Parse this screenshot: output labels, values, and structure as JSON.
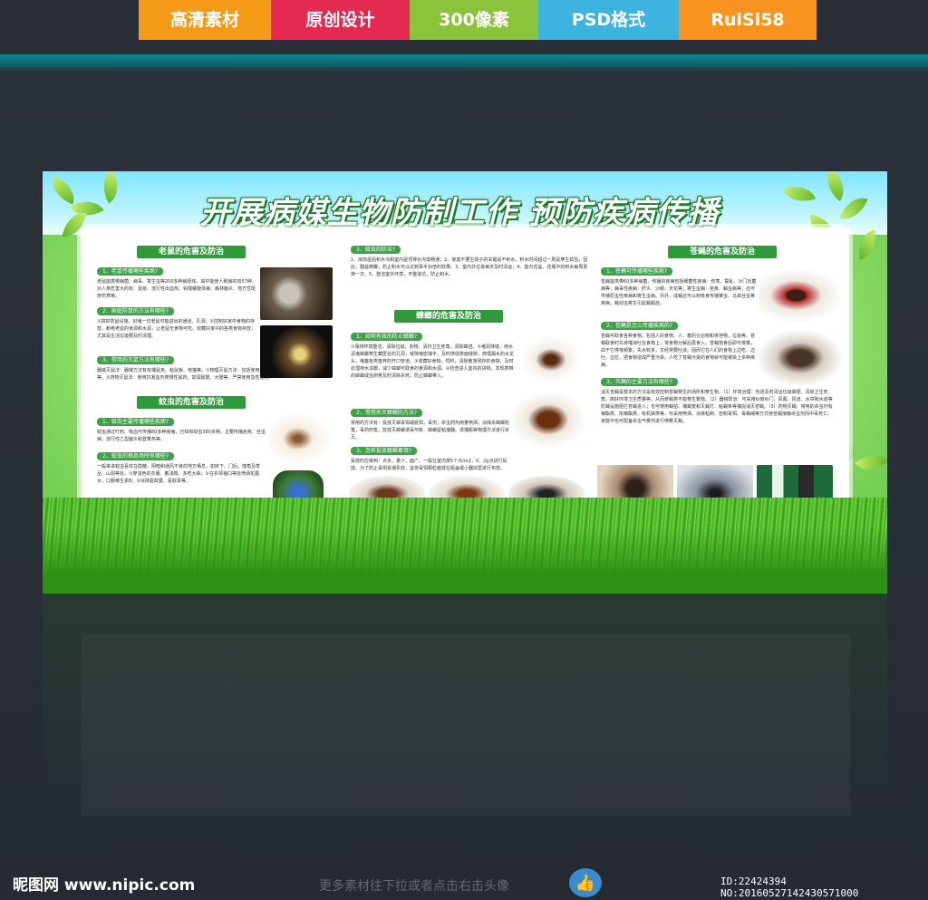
{
  "tags": [
    {
      "label": "高清素材",
      "color": "#f59a16"
    },
    {
      "label": "原创设计",
      "color": "#e42a50"
    },
    {
      "label": "300像素",
      "color": "#8bc33a"
    },
    {
      "label": "PSD格式",
      "color": "#3cb4df"
    },
    {
      "label": "RuiSi58",
      "color": "#f7931e"
    }
  ],
  "board": {
    "title": "开展病媒生物防制工作 预防疾病传播",
    "sections": {
      "rats": "老鼠的危害及防治",
      "mosquito": "蚊虫的危害及防治",
      "mosquito_cont": "3、蚊虫的防治?",
      "cockroach": "蟑螂的危害及防治",
      "fly": "苍蝇的危害及防治"
    },
    "subs": {
      "rat1": "1、老鼠传播哪些疾病?",
      "rat2": "2、家庭防鼠的方法有哪些?",
      "rat3": "3、常用的灭鼠方法有哪些?",
      "mos1": "1、蚊虫主要传播哪些疾病?",
      "mos2": "2、蚊虫的栖息场所有哪些?",
      "roach1": "1、如何有效的防止蟑螂?",
      "roach2": "2、常用杀灭蟑螂的方法?",
      "roach3": "3、怎样投放蟑螂毒饵?",
      "fly1": "1、苍蝇可传播哪些疾病?",
      "fly2": "2、苍蝇是怎么传播疾病的?",
      "fly3": "3、灭蝇的主要方法有哪些?"
    },
    "paras": {
      "rat1": "老鼠能携带病菌、病毒、寄生虫等200多种病原体，其中能使人致病的有57种，对人类危害大的有：鼠疫、流行性出血热、钩端螺旋体病、森林脑炎、地方性斑疹伤寒等。",
      "rat2": "①搞好防鼠设施，封堵一切老鼠可能进出的通道、孔洞；②控制好家中食物的存放，断绝老鼠的食源和水源，让老鼠无食物可吃。收藏好家中的各类食物存放；尤其是生活垃圾要及时清理。",
      "rat3": "器械灭鼠法：器械方法有有捕鼠夹、粘鼠板、电猫等。①物理灭鼠方法：包括使用鼠夹、鼠笼、粘鼠板、电猫等。②药物灭鼠法：使用抗凝血剂类慢性鼠药，如溴敌隆、大隆等，严禁使用急性鼠药。",
      "mos1": "蚊虫通过叮刺、吸血可传播80多种疾病，已知有蚊虫380多种。主要传播疟疾、丝虫病、流行性乙型脑炎和登革热等。",
      "mos2": "一般来讲蚊虫喜欢在隐蔽、阴暗和通风不良的地方栖息，如床下、门后、墙角及草丛、山洞等处。①穿浅色的衣服、戴浅帽、多吃大蒜；②在衣领袖口等处喷洒花露水，口服维生素B；③涂抹驱蚊露、驱蚊膏等。",
      "mos3": "1、房前屋后积水沟和室内屋顶排水沟需畅通；2、家庭不要生蚊子的关键是不积水，积水时间超过一周是孳生蚊虫，因此，翻盆倒罐，防止积水可以达到事半功倍的效果。3、室内外垃圾每天及时清运；4、室内花盆、花瓶中的积水每周更换一次。5、整洁室外环境，平整道坑，防止积水。",
      "roach1": "①保持环境整洁，清除垃圾、杂物，清扫卫生死角，清除蟑迹。②堵洞抹缝，用水泥堵蟑螂孳生藏匿处的孔洞，缝隙堵密填平，及时修缮表面缝隙，修理漏水的水龙头，堵塞各类废弃的开口管道。③收藏好食物，饲料，清除散落残存的食物，及时处理用水泔脚，减少蟑螂可取食的食源和水源。④检查进入室内的货物，发现携带的蟑螂成虫卵荚及时清除杀死，防止蟑螂带入。",
      "roach2": "常用的方法有：投放灭蟑毒饵或胶饵，毒剂；杀虫药剂用量喷洒；涂抹杀蟑螂粉笔，毒药药笔，放放灭蟑螂诱毒剂条、蟑螂屋粘捕器、诱捕瓶等物理方法进行杀灭。",
      "roach3": "投放时应做到：点多，量少，面广。一般在室内按5个点/m2，0、2g点进行投放。为了防止毒饵受潮失效，宜将毒饵颗粒盛放在瓶盖或小器皿里进行布放。",
      "fly1": "苍蝇能携带60多种病菌、传播的疾病包括细菌性疾病：伤寒、霍乱、沙门氏菌病等；病毒性疾病：肝炎、沙眼、天花等；寄生虫病：疟疾、蛔虫病等；还可传播原虫性疾病和寄生虫病。另外，成蝇还可以刺吸食传播锥虫、马来丝虫等疾病，蝇幼虫寄生引起蝇蛆症。",
      "fly2": "苍蝇可取食各种食物，包括人的食物、人、畜的分泌物和排泄物，垃圾等。苍蝇取食时先将唾液吐在食物上，将食物分解后再食入。苍蝇饱食后即可排粪，由于它停落频繁，失水较多，又经常要吐液。因而它在人们的食物上边吃、边吐、边拉，把食物造成严重污染。人吃了苍蝇污染的食物就可能被染上多种疾病。",
      "fly3": "消灭苍蝇是根本的方法是有效控制苍蝇孳生的场所和孳生物。（1）环境治理：包括及时清运垃圾粪便、清除卫生死角，搞好环境卫生质量等，从而使蝇类不能孳生繁殖。（2）器械防治：可采用纱窗纱门、风幕、风道、水帘和水道等防蝇设施阻拦苍蝇进入；也可使用蝇拍、捕蝇笼和灭蝇灯、粘蝇条等捕捉消灭苍蝇。（3）药物灭蝇：常用的杀虫剂有菊酯类、拟菊酯类、有机磷类等，可采用喷洒、涂抹粘刷、自制毒饵、毒蝇绳等方式使苍蝇接触杀虫剂而中毒死亡。家庭中也可配备杀虫气雾剂进行喷雾灭蝇。"
    }
  },
  "footer": {
    "logo": "昵图网 www.nipic.com",
    "hint": "更多素材往下拉或者点击右击头像",
    "thumb_icon": "thumbs-up-icon",
    "id_text": "ID:22424394 NO:20160527142430571000"
  }
}
